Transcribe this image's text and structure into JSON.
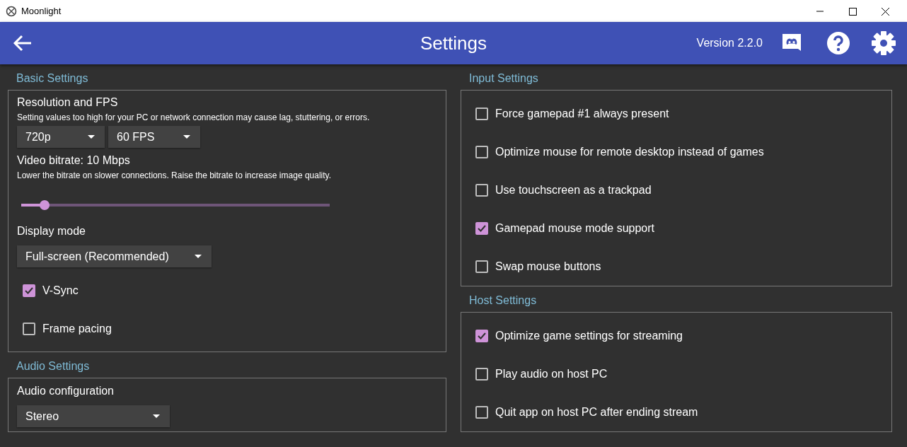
{
  "window": {
    "title": "Moonlight"
  },
  "header": {
    "title": "Settings",
    "version": "Version 2.2.0"
  },
  "columns": [
    {
      "sections": [
        {
          "title": "Basic Settings",
          "items": [
            {
              "kind": "dropdowns",
              "label": "Resolution and FPS",
              "description": "Setting values too high for your PC or network connection may cause lag, stuttering, or errors.",
              "dropdowns": [
                "720p",
                "60 FPS"
              ]
            },
            {
              "kind": "slider",
              "label": "Video bitrate: 10 Mbps",
              "description": "Lower the bitrate on slower connections. Raise the bitrate to increase image quality.",
              "level": 0.076
            },
            {
              "kind": "dropdown",
              "label": "Display mode",
              "value": "Full-screen (Recommended)"
            },
            {
              "kind": "checkbox",
              "label": "V-Sync",
              "checked": true
            },
            {
              "kind": "checkbox",
              "label": "Frame pacing",
              "checked": false
            }
          ]
        },
        {
          "title": "Audio Settings",
          "items": [
            {
              "kind": "dropdown",
              "label": "Audio configuration",
              "value": "Stereo"
            }
          ]
        }
      ]
    },
    {
      "sections": [
        {
          "title": "Input Settings",
          "items": [
            {
              "kind": "checkbox",
              "label": "Force gamepad #1 always present",
              "checked": false
            },
            {
              "kind": "checkbox",
              "label": "Optimize mouse for remote desktop instead of games",
              "checked": false
            },
            {
              "kind": "checkbox",
              "label": "Use touchscreen as a trackpad",
              "checked": false
            },
            {
              "kind": "checkbox",
              "label": "Gamepad mouse mode support",
              "checked": true
            },
            {
              "kind": "checkbox",
              "label": "Swap mouse buttons",
              "checked": false
            }
          ]
        },
        {
          "title": "Host Settings",
          "items": [
            {
              "kind": "checkbox",
              "label": "Optimize game settings for streaming",
              "checked": true
            },
            {
              "kind": "checkbox",
              "label": "Play audio on host PC",
              "checked": false
            },
            {
              "kind": "checkbox",
              "label": "Quit app on host PC after ending stream",
              "checked": false
            }
          ]
        }
      ]
    }
  ]
}
